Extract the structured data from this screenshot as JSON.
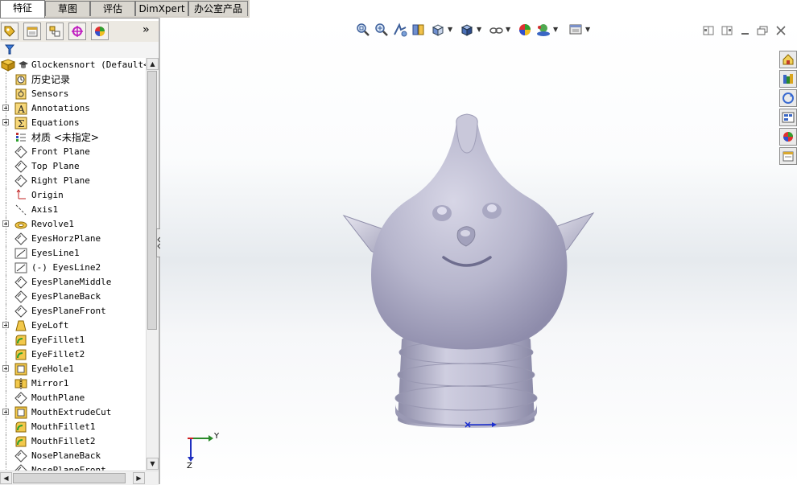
{
  "tabs": [
    "特征",
    "草图",
    "评估",
    "DimXpert",
    "办公室产品"
  ],
  "panel_toolbar": {
    "buttons": [
      "featuremanager-icon",
      "propertymanager-icon",
      "configurationmanager-icon",
      "dimxpertmanager-icon",
      "displaymanager-icon"
    ],
    "expand": "»"
  },
  "tree": {
    "root": "Glockensnort  (Default<<",
    "items": [
      {
        "label": "历史记录",
        "icon": "history-icon",
        "expand": false,
        "cn": true
      },
      {
        "label": "Sensors",
        "icon": "sensor-icon",
        "expand": false
      },
      {
        "label": "Annotations",
        "icon": "annotation-icon",
        "expand": true
      },
      {
        "label": "Equations",
        "icon": "equation-icon",
        "expand": true
      },
      {
        "label": "材质 <未指定>",
        "icon": "material-icon",
        "expand": false,
        "cn": true
      },
      {
        "label": "Front Plane",
        "icon": "plane-icon",
        "expand": false
      },
      {
        "label": "Top Plane",
        "icon": "plane-icon",
        "expand": false
      },
      {
        "label": "Right Plane",
        "icon": "plane-icon",
        "expand": false
      },
      {
        "label": "Origin",
        "icon": "origin-icon",
        "expand": false
      },
      {
        "label": "Axis1",
        "icon": "axis-icon",
        "expand": false
      },
      {
        "label": "Revolve1",
        "icon": "revolve-icon",
        "expand": true
      },
      {
        "label": "EyesHorzPlane",
        "icon": "plane-icon",
        "expand": false
      },
      {
        "label": "EyesLine1",
        "icon": "sketch-icon",
        "expand": false
      },
      {
        "label": "(-) EyesLine2",
        "icon": "sketch-icon",
        "expand": false
      },
      {
        "label": "EyesPlaneMiddle",
        "icon": "plane-icon",
        "expand": false
      },
      {
        "label": "EyesPlaneBack",
        "icon": "plane-icon",
        "expand": false
      },
      {
        "label": "EyesPlaneFront",
        "icon": "plane-icon",
        "expand": false
      },
      {
        "label": "EyeLoft",
        "icon": "loft-icon",
        "expand": true
      },
      {
        "label": "EyeFillet1",
        "icon": "fillet-icon",
        "expand": false
      },
      {
        "label": "EyeFillet2",
        "icon": "fillet-icon",
        "expand": false
      },
      {
        "label": "EyeHole1",
        "icon": "cut-icon",
        "expand": true
      },
      {
        "label": "Mirror1",
        "icon": "mirror-icon",
        "expand": false
      },
      {
        "label": "MouthPlane",
        "icon": "plane-icon",
        "expand": false
      },
      {
        "label": "MouthExtrudeCut",
        "icon": "cut-icon",
        "expand": true
      },
      {
        "label": "MouthFillet1",
        "icon": "fillet-icon",
        "expand": false
      },
      {
        "label": "MouthFillet2",
        "icon": "fillet-icon",
        "expand": false
      },
      {
        "label": "NosePlaneBack",
        "icon": "plane-icon",
        "expand": false
      },
      {
        "label": "NosePlaneFront",
        "icon": "plane-icon",
        "expand": false
      }
    ]
  },
  "heads_up_toolbar": [
    "zoom-to-fit-icon",
    "zoom-to-area-icon",
    "previous-view-icon",
    "section-view-icon",
    "view-orientation-icon",
    "display-style-icon",
    "hide-show-items-icon",
    "edit-appearance-icon",
    "apply-scene-icon",
    "view-settings-icon"
  ],
  "task_pane": [
    "solidworks-resources-icon",
    "design-library-icon",
    "file-explorer-icon",
    "view-palette-icon",
    "appearances-icon",
    "custom-properties-icon"
  ],
  "triad": {
    "y": "Y",
    "z": "Z"
  },
  "colors": {
    "accent": "#316ac5",
    "model": "#c3c3d6",
    "panel_bg": "#d4d0c8"
  }
}
